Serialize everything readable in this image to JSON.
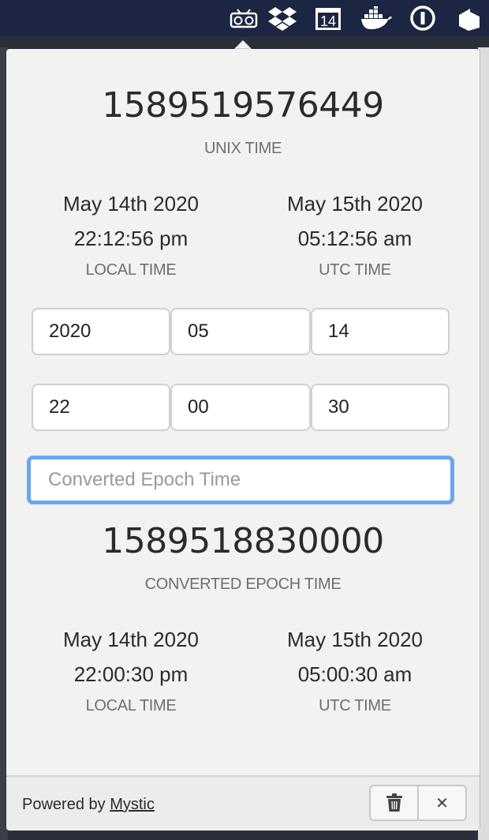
{
  "menubar": {
    "icons": [
      "radio-icon",
      "dropbox-icon",
      "calendar-icon",
      "docker-icon",
      "onepassword-icon",
      "box-icon"
    ],
    "calendar_day": "14"
  },
  "unix": {
    "value": "1589519576449",
    "caption": "UNIX TIME",
    "local": {
      "date": "May 14th 2020",
      "time": "22:12:56 pm",
      "label": "LOCAL TIME"
    },
    "utc": {
      "date": "May 15th 2020",
      "time": "05:12:56 am",
      "label": "UTC TIME"
    }
  },
  "inputs": {
    "year": "2020",
    "month": "05",
    "day": "14",
    "hour": "22",
    "minute": "00",
    "second": "30"
  },
  "epoch_input": {
    "placeholder": "Converted Epoch Time",
    "value": ""
  },
  "converted": {
    "value": "1589518830000",
    "caption": "CONVERTED EPOCH TIME",
    "local": {
      "date": "May 14th 2020",
      "time": "22:00:30 pm",
      "label": "LOCAL TIME"
    },
    "utc": {
      "date": "May 15th 2020",
      "time": "05:00:30 am",
      "label": "UTC TIME"
    }
  },
  "footer": {
    "powered_prefix": "Powered by",
    "powered_link": "Mystic",
    "close_symbol": "✕"
  }
}
